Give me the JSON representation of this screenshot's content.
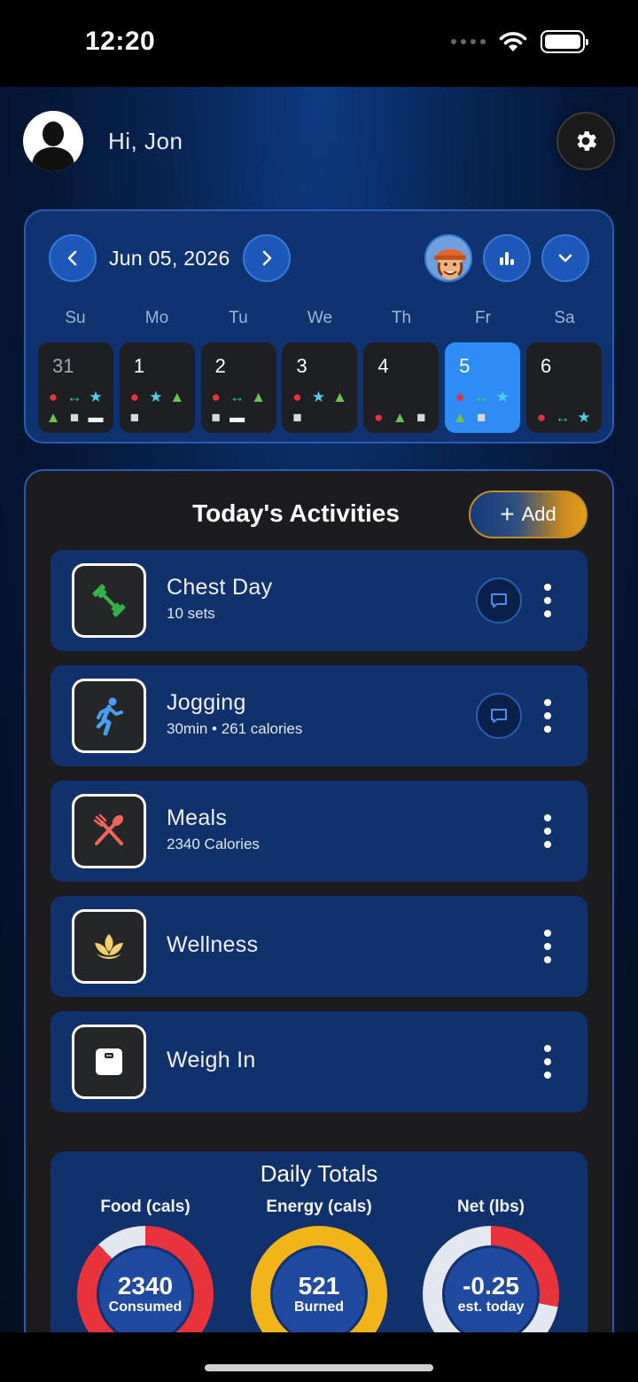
{
  "status_bar": {
    "time": "12:20"
  },
  "header": {
    "greeting": "Hi, Jon"
  },
  "calendar": {
    "date_label": "Jun 05, 2026",
    "weekdays": [
      "Su",
      "Mo",
      "Tu",
      "We",
      "Th",
      "Fr",
      "Sa"
    ],
    "days": [
      {
        "num": "31",
        "icons": [
          "apple",
          "dumbbell",
          "run",
          "salad",
          "scale",
          "book"
        ]
      },
      {
        "num": "1",
        "icons": [
          "apple",
          "run",
          "salad",
          "scale"
        ]
      },
      {
        "num": "2",
        "icons": [
          "apple",
          "dumbbell",
          "salad",
          "scale",
          "book"
        ]
      },
      {
        "num": "3",
        "icons": [
          "apple",
          "run",
          "salad",
          "scale"
        ]
      },
      {
        "num": "4",
        "icons": [
          "apple",
          "salad",
          "scale"
        ]
      },
      {
        "num": "5",
        "icons": [
          "apple",
          "dumbbell",
          "run",
          "salad",
          "scale"
        ],
        "selected": true
      },
      {
        "num": "6",
        "icons": [
          "apple",
          "dumbbell",
          "run"
        ]
      }
    ]
  },
  "activities": {
    "title": "Today's Activities",
    "add_label": "Add",
    "items": [
      {
        "name": "Chest Day",
        "sub": "10 sets",
        "icon": "dumbbell-icon",
        "has_comment": true
      },
      {
        "name": "Jogging",
        "sub": "30min • 261 calories",
        "icon": "running-icon",
        "has_comment": true
      },
      {
        "name": "Meals",
        "sub": "2340 Calories",
        "icon": "utensils-icon",
        "has_comment": false
      },
      {
        "name": "Wellness",
        "sub": "",
        "icon": "lotus-icon",
        "has_comment": false
      },
      {
        "name": "Weigh In",
        "sub": "",
        "icon": "scale-icon",
        "has_comment": false
      }
    ]
  },
  "totals": {
    "title": "Daily Totals",
    "gauges": [
      {
        "label": "Food (cals)",
        "value": "2340",
        "caption": "Consumed",
        "fill": 0.88,
        "color": "#e8333d"
      },
      {
        "label": "Energy (cals)",
        "value": "521",
        "caption": "Burned",
        "fill": 1.0,
        "color": "#f2b519"
      },
      {
        "label": "Net (lbs)",
        "value": "-0.25",
        "caption": "est. today",
        "fill": 0.28,
        "color": "#e8333d"
      }
    ]
  },
  "colors": {
    "accent_blue": "#2f8cf5",
    "card_blue": "#10316b",
    "add_gold": "#e5a020"
  }
}
